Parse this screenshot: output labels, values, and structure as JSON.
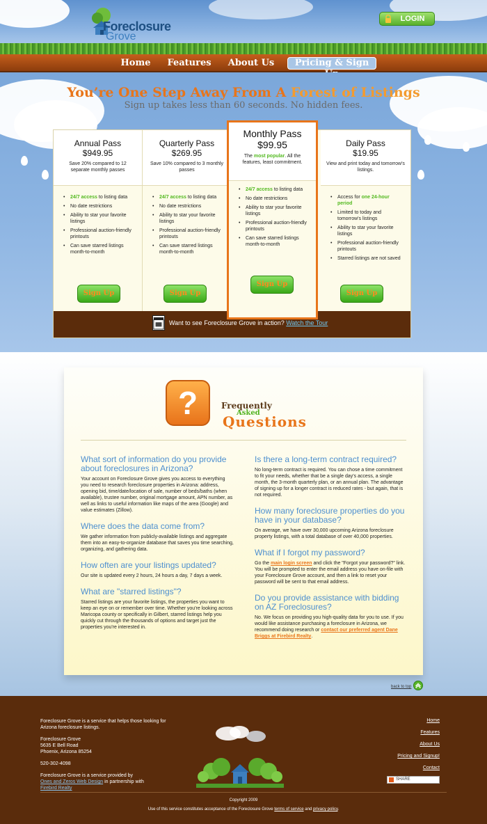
{
  "header": {
    "logo_line1": "Foreclosure",
    "logo_line2": "Grove",
    "login_label": "LOGIN"
  },
  "nav": {
    "items": [
      {
        "label": "Home"
      },
      {
        "label": "Features"
      },
      {
        "label": "About Us"
      },
      {
        "label": "Pricing & Sign Up",
        "active": true
      }
    ]
  },
  "hero": {
    "title_part1": "You’re One Step Away From A ",
    "title_part2": "Forest of Listings",
    "subtitle": "Sign up takes less than 60 seconds. No hidden fees."
  },
  "pricing": {
    "signup_label": "Sign Up",
    "plans": [
      {
        "name": "Annual Pass",
        "price": "$949.95",
        "note": "Save 20% compared to 12 separate monthly passes",
        "features": [
          "24/7 access",
          " to listing data",
          "No date restrictions",
          "Ability to star your favorite listings",
          "Professional auction-friendly printouts",
          "Can save starred listings month-to-month"
        ]
      },
      {
        "name": "Quarterly Pass",
        "price": "$269.95",
        "note": "Save 10% compared to 3 monthly passes",
        "features": [
          "24/7 access",
          " to listing data",
          "No date restrictions",
          "Ability to star your favorite listings",
          "Professional auction-friendly printouts",
          "Can save starred listings month-to-month"
        ]
      },
      {
        "name": "Monthly Pass",
        "price": "$99.95",
        "note_prefix": "The ",
        "note_highlight": "most popular",
        "note_suffix": ". All the features, least commitment.",
        "features": [
          "24/7 access",
          " to listing data",
          "No date restrictions",
          "Ability to star your favorite listings",
          "Professional auction-friendly printouts",
          "Can save starred listings month-to-month"
        ]
      },
      {
        "name": "Daily Pass",
        "price": "$19.95",
        "note": "View and print today and tomorrow's listings.",
        "features": [
          "Access for ",
          "one 24-hour period",
          "Limited to today and tomorrow's listings",
          "Ability to star your favorite listings",
          "Professional auction-friendly printouts",
          "Starred listings are not saved"
        ]
      }
    ],
    "tour_text": "Want to see Foreclosure Grove in action? ",
    "tour_link": "Watch the Tour"
  },
  "faq": {
    "heading_line1": "Frequently",
    "heading_line2": "Asked",
    "heading_line3": "Questions",
    "left": [
      {
        "q": "What sort of information do you provide about foreclosures in Arizona?",
        "a": "Your account on Foreclosure Grove gives you access to everything you need to research foreclosure properties in Arizona: address, opening bid, time/date/location of sale, number of beds/baths (when available), trustee number, original mortgage amount, APN number, as well as links to useful information like maps of the area (Google) and value estimates (Zillow)."
      },
      {
        "q": "Where does the data come from?",
        "a": "We gather information from publicly-available listings and aggregate them into an easy-to-organize database that saves you time searching, organizing, and gathering data."
      },
      {
        "q": "How often are your listings updated?",
        "a": "Our site is updated every 2 hours, 24 hours a day, 7 days a week."
      },
      {
        "q": "What are \"starred listings\"?",
        "a": "Starred listings are your favorite listings, the properties you want to keep an eye on or remember over time. Whether you're looking across Maricopa county or specifically in Gilbert, starred listings help you quickly cut through the thousands of options and target just the properties you're interested in."
      }
    ],
    "right": [
      {
        "q": "Is there a long-term contract required?",
        "a": "No long-term contract is required. You can chose a time commitment to fit your needs, whether that be a single day's access, a single month, the 3-month quarterly plan, or an annual plan. The advantage of signing up for a longer contract is reduced rates - but again, that is not required."
      },
      {
        "q": "How many foreclosure properties do you have in your database?",
        "a": "On average, we have over 30,000 upcoming Arizona foreclosure property listings, with a total database of over 40,000 properties."
      },
      {
        "q": "What if I forgot my password?",
        "a_pre": "Go the ",
        "a_link": "main login screen",
        "a_post": " and click the \"Forgot your password?\" link. You will be prompted to enter the email address you have on-file with your Foreclosure Grove account, and then a link to reset your password will be sent to that email address."
      },
      {
        "q": "Do you provide assistance with bidding on AZ Foreclosures?",
        "a_pre": "No. We focus on providing you high-quality data for you to use. If you would like assistance purchasing a foreclosure in Arizona, we recommend doing research or ",
        "a_link": "contact our preferred agent Dane Briggs at Firebird Realty",
        "a_post": "."
      }
    ],
    "back_to_top": "back to top"
  },
  "footer": {
    "about": "Foreclosure Grove is a service that helps those looking for Arizona foreclosure listings.",
    "address_name": "Foreclosure Grove",
    "address_street": "5635 E Bell Road",
    "address_city": "Phoenix, Arizona 85254",
    "phone": "520-302-4098",
    "credit_pre": "Foreclosure Grove is a service provided by",
    "credit_link1": "Ones and Zeros Web Design",
    "credit_mid": " in partnership with",
    "credit_link2": "Firebird Realty",
    "links": [
      "Home",
      "Features",
      "About Us",
      "Pricing and Signup!",
      "Contact"
    ],
    "share_label": "SHARE",
    "copyright": "Copyright 2009",
    "terms_pre": "Use of this service constitutes acceptance of the Foreclosure Grove ",
    "terms_link": "terms of service",
    "terms_mid": " and ",
    "privacy_link": "privacy policy",
    "terms_post": "."
  }
}
